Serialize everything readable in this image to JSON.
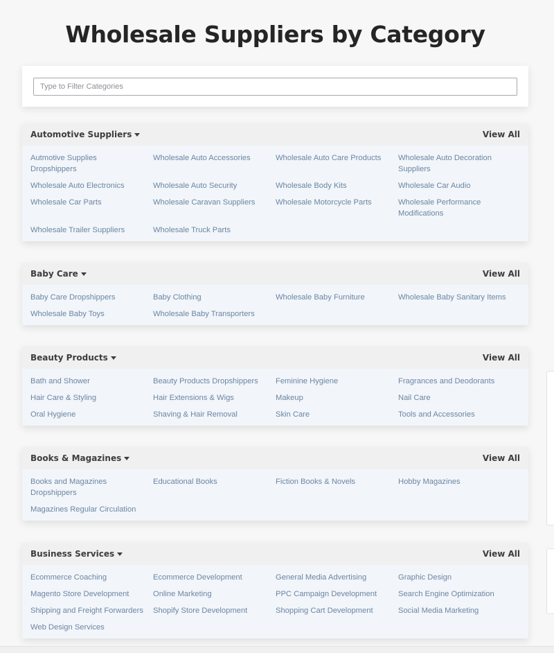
{
  "page": {
    "title": "Wholesale Suppliers by Category"
  },
  "filter": {
    "placeholder": "Type to Filter Categories"
  },
  "view_all_label": "View All",
  "categories": [
    {
      "name": "Automotive Suppliers",
      "items": [
        "Autmotive Supplies Dropshippers",
        "Wholesale Auto Accessories",
        "Wholesale Auto Care Products",
        "Wholesale Auto Decoration Suppliers",
        "Wholesale Auto Electronics",
        "Wholesale Auto Security",
        "Wholesale Body Kits",
        "Wholesale Car Audio",
        "Wholesale Car Parts",
        "Wholesale Caravan Suppliers",
        "Wholesale Motorcycle Parts",
        "Wholesale Performance Modifications",
        "Wholesale Trailer Suppliers",
        "Wholesale Truck Parts"
      ]
    },
    {
      "name": "Baby Care",
      "items": [
        "Baby Care Dropshippers",
        "Baby Clothing",
        "Wholesale Baby Furniture",
        "Wholesale Baby Sanitary Items",
        "Wholesale Baby Toys",
        "Wholesale Baby Transporters"
      ]
    },
    {
      "name": "Beauty Products",
      "items": [
        "Bath and Shower",
        "Beauty Products Dropshippers",
        "Feminine Hygiene",
        "Fragrances and Deodorants",
        "Hair Care & Styling",
        "Hair Extensions & Wigs",
        "Makeup",
        "Nail Care",
        "Oral Hygiene",
        "Shaving & Hair Removal",
        "Skin Care",
        "Tools and Accessories"
      ]
    },
    {
      "name": "Books & Magazines",
      "items": [
        "Books and Magazines Dropshippers",
        "Educational Books",
        "Fiction Books & Novels",
        "Hobby Magazines",
        "Magazines Regular Circulation"
      ]
    },
    {
      "name": "Business Services",
      "items": [
        "Ecommerce Coaching",
        "Ecommerce Development",
        "General Media Advertising",
        "Graphic Design",
        "Magento Store Development",
        "Online Marketing",
        "PPC Campaign Development",
        "Search Engine Optimization",
        "Shipping and Freight Forwarders",
        "Shopify Store Development",
        "Shopping Cart Development",
        "Social Media Marketing",
        "Web Design Services"
      ]
    }
  ]
}
